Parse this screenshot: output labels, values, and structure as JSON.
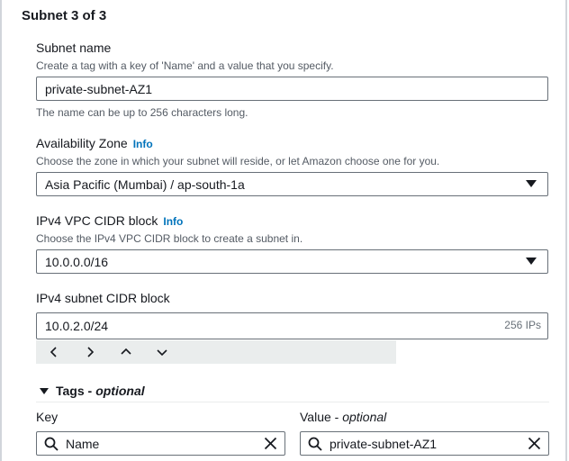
{
  "section": {
    "title": "Subnet 3 of 3"
  },
  "subnet_name": {
    "label": "Subnet name",
    "description": "Create a tag with a key of 'Name' and a value that you specify.",
    "value": "private-subnet-AZ1",
    "hint": "The name can be up to 256 characters long."
  },
  "availability_zone": {
    "label": "Availability Zone",
    "info": "Info",
    "description": "Choose the zone in which your subnet will reside, or let Amazon choose one for you.",
    "value": "Asia Pacific (Mumbai) / ap-south-1a"
  },
  "vpc_cidr": {
    "label": "IPv4 VPC CIDR block",
    "info": "Info",
    "description": "Choose the IPv4 VPC CIDR block to create a subnet in.",
    "value": "10.0.0.0/16"
  },
  "subnet_cidr": {
    "label": "IPv4 subnet CIDR block",
    "value": "10.0.2.0/24",
    "ip_count": "256 IPs"
  },
  "tags": {
    "title": "Tags -",
    "optional": "optional",
    "key_label": "Key",
    "value_label": "Value -",
    "value_optional": "optional",
    "key_value": "Name",
    "value_value": "private-subnet-AZ1"
  }
}
